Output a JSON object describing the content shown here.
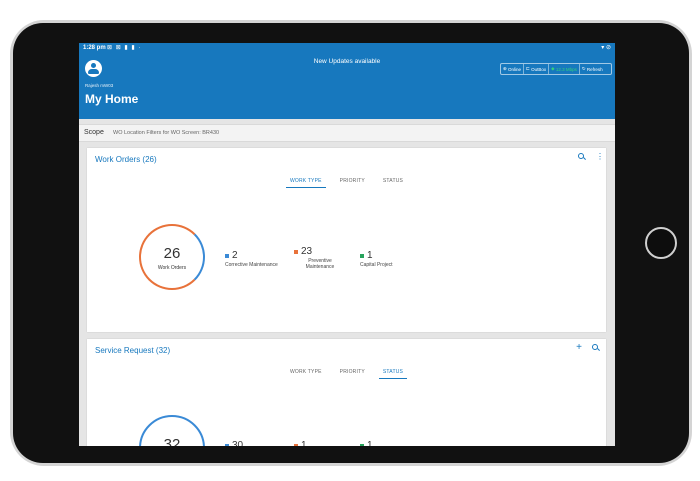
{
  "status_bar": {
    "time": "1:28 pm",
    "icons_left": "⊠ ⊠ ▮ ▮ ·",
    "icons_right": "▾ ⊘"
  },
  "header": {
    "updates": "New Updates available",
    "user_name": "Rajesh mW03",
    "title": "My Home",
    "toolbar": {
      "online": "Online",
      "outbox": "OutBox",
      "speed": "12.3 Mbps",
      "refresh": "Refresh"
    }
  },
  "scope": {
    "label": "Scope",
    "value": "WO Location Filters for WO Screen: BR430"
  },
  "work_orders": {
    "title": "Work Orders (26)",
    "tabs": [
      "WORK TYPE",
      "PRIORITY",
      "STATUS"
    ],
    "active_tab": "WORK TYPE",
    "total": "26",
    "total_label": "Work Orders",
    "stats": [
      {
        "value": "2",
        "label": "Corrective Maintenance",
        "color": "#3a8ad6"
      },
      {
        "value": "23",
        "label": "Preventive Maintenance",
        "color": "#e8723a"
      },
      {
        "value": "1",
        "label": "Capital Project",
        "color": "#27a35c"
      }
    ]
  },
  "service_request": {
    "title": "Service Request (32)",
    "tabs": [
      "WORK TYPE",
      "PRIORITY",
      "STATUS"
    ],
    "active_tab": "STATUS",
    "total": "32",
    "stats": [
      {
        "value": "30",
        "color": "#3a8ad6"
      },
      {
        "value": "1",
        "color": "#e8723a"
      },
      {
        "value": "1",
        "color": "#27a35c"
      }
    ]
  }
}
